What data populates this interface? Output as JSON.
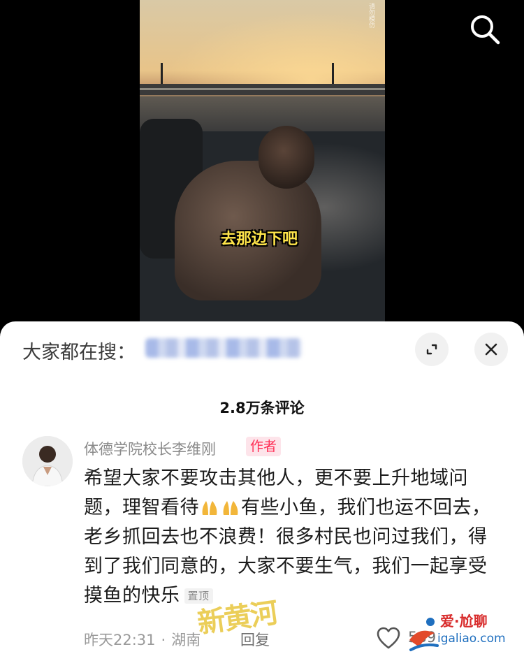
{
  "video": {
    "watermark_small": "请勿模仿",
    "subtitle": "去那边下吧"
  },
  "search": {
    "prefix": "大家都在搜："
  },
  "comments": {
    "count_label": "2.8万条评论",
    "items": [
      {
        "username": "体德学院校长李维刚",
        "author_tag": "作者",
        "text_1": "希望大家不要攻击其他人，更不要上升地域问题，理智看待",
        "text_2": "有些小鱼，我们也运不回去，老乡抓回去也不浪费！很多村民也问过我们，得到了我们同意的，大家不要生气，我们一起享受摸鱼的快乐",
        "pin_tag": "置顶",
        "time": "昨天22:31",
        "location": "湖南",
        "reply_label": "回复",
        "likes": "589"
      }
    ]
  },
  "overlay": {
    "stamp": "新黄河",
    "site_name": "爱·尬聊",
    "site_domain": "igaliao.com"
  },
  "icons": {
    "search": "search-icon",
    "expand": "expand-icon",
    "close": "close-icon",
    "like": "heart-icon",
    "emoji": "praying-hands-emoji"
  },
  "colors": {
    "author_tag_text": "#ff2d55",
    "author_tag_bg": "#fde4ea",
    "subtitle": "#ffe54a"
  }
}
